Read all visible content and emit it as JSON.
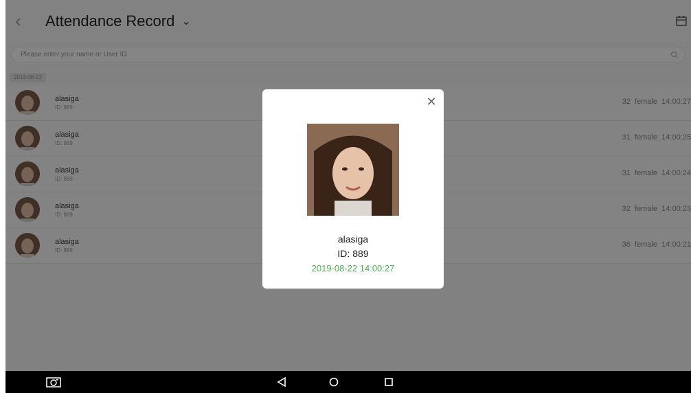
{
  "header": {
    "title": "Attendance Record",
    "back_icon": "chevron-left-icon",
    "dropdown_icon": "chevron-down-icon",
    "calendar_icon": "calendar-icon"
  },
  "search": {
    "placeholder": "Please enter your name or User ID",
    "icon": "search-icon"
  },
  "date_group": {
    "label": "2019-08-22"
  },
  "records": [
    {
      "name": "alasiga",
      "id_label": "ID: 889",
      "age": "32",
      "gender": "female",
      "time": "14:00:27"
    },
    {
      "name": "alasiga",
      "id_label": "ID: 889",
      "age": "31",
      "gender": "female",
      "time": "14:00:25"
    },
    {
      "name": "alasiga",
      "id_label": "ID: 889",
      "age": "31",
      "gender": "female",
      "time": "14:00:24"
    },
    {
      "name": "alasiga",
      "id_label": "ID: 889",
      "age": "32",
      "gender": "female",
      "time": "14:00:23"
    },
    {
      "name": "alasiga",
      "id_label": "ID: 889",
      "age": "36",
      "gender": "female",
      "time": "14:00:21"
    }
  ],
  "modal": {
    "name": "alasiga",
    "id_label": "ID: 889",
    "timestamp": "2019-08-22 14:00:27",
    "close_icon": "close-icon"
  },
  "navbar": {
    "camera_icon": "camera-icon",
    "back_icon": "triangle-back-icon",
    "home_icon": "circle-home-icon",
    "recent_icon": "square-recent-icon"
  },
  "colors": {
    "accent_green": "#4caf50",
    "overlay": "#000000"
  }
}
